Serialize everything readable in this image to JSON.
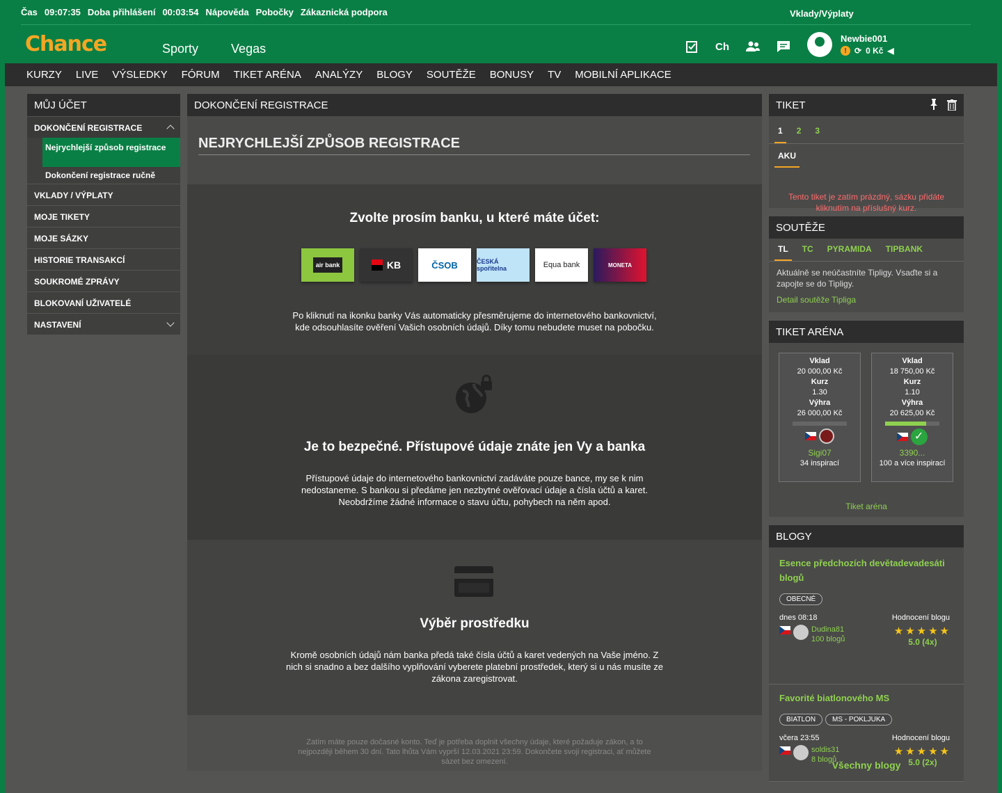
{
  "topbar": {
    "time_label": "Čas",
    "time": "09:07:35",
    "login_label": "Doba přihlášení",
    "login_time": "00:03:54",
    "links": [
      "Nápověda",
      "Pobočky",
      "Zákaznická podpora"
    ],
    "deposits": "Vklady/Výplaty"
  },
  "header": {
    "logo": "Chance",
    "nav": [
      "Sporty",
      "Vegas"
    ],
    "icons": [
      "ticket-check-icon",
      "ch-logo-icon",
      "users-icon",
      "chat-icon"
    ],
    "ch_text": "Ch",
    "user": {
      "name": "Newbie001",
      "warn": "!",
      "balance": "0 Kč"
    }
  },
  "mainnav": [
    "KURZY",
    "LIVE",
    "VÝSLEDKY",
    "FÓRUM",
    "TIKET ARÉNA",
    "ANALÝZY",
    "BLOGY",
    "SOUTĚŽE",
    "BONUSY",
    "TV",
    "MOBILNÍ APLIKACE"
  ],
  "leftmenu": {
    "title": "MŮJ ÚČET",
    "open_item": "DOKONČENÍ REGISTRACE",
    "subitems": [
      "Nejrychlejší způsob registrace",
      "Dokončení registrace ručně"
    ],
    "items": [
      "VKLADY / VÝPLATY",
      "MOJE TIKETY",
      "MOJE SÁZKY",
      "HISTORIE TRANSAKCÍ",
      "SOUKROMÉ ZPRÁVY",
      "BLOKOVANÍ UŽIVATELÉ",
      "NASTAVENÍ"
    ]
  },
  "center": {
    "title": "DOKONČENÍ REGISTRACE",
    "heading": "NEJRYCHLEJŠÍ ZPŮSOB REGISTRACE",
    "choose": "Zvolte prosím banku, u které máte účet:",
    "banks": [
      "air bank",
      "KB",
      "ČSOB",
      "ČESKÁ spořitelna",
      "Equa bank",
      "MONETA"
    ],
    "info1": "Po kliknutí na ikonku banky Vás automaticky přesměrujeme do internetového bankovnictví, kde odsouhlasíte ověření Vašich osobních údajů. Díky tomu nebudete muset na pobočku.",
    "safe_title": "Je to bezpečné. Přístupové údaje znáte jen Vy a banka",
    "safe_text": "Přístupové údaje do internetového bankovnictví zadáváte pouze bance, my se k nim nedostaneme. S bankou si předáme jen nezbytné ověřovací údaje a čísla účtů a karet. Neobdržíme žádné informace o stavu účtu, pohybech na něm apod.",
    "choice_title": "Výběr prostředku",
    "choice_text": "Kromě osobních údajů nám banka předá také čísla účtů a karet vedených na Vaše jméno. Z nich si snadno a bez dalšího vyplňování vyberete platební prostředek, který si u nás musíte ze zákona zaregistrovat.",
    "footer": "Zatím máte pouze dočasné konto. Teď je potřeba doplnit všechny údaje, které požaduje zákon, a to nejpozději během 30 dní. Tato lhůta Vám vyprší 12.03.2021 23:59. Dokončete svoji registraci, ať můžete sázet bez omezení."
  },
  "ticket": {
    "title": "TIKET",
    "tabs": [
      "1",
      "2",
      "3"
    ],
    "type": "AKU",
    "empty": "Tento tiket je zatím prázdný, sázku přidáte kliknutím na příslušný kurz."
  },
  "contests": {
    "title": "SOUTĚŽE",
    "tabs": [
      "TL",
      "TC",
      "PYRAMIDA",
      "TIPBANK"
    ],
    "text": "Aktuálně se neúčastníte Tipligy. Vsaďte si a zapojte se do Tipligy.",
    "link": "Detail soutěže Tipliga"
  },
  "arena": {
    "title": "TIKET ARÉNA",
    "stake_label": "Vklad",
    "odds_label": "Kurz",
    "win_label": "Výhra",
    "cards": [
      {
        "stake": "20 000,00 Kč",
        "odds": "1.30",
        "win": "26 000,00 Kč",
        "progress": 0,
        "flag": "CZ",
        "user": "Sigi07",
        "inspirations": "34 inspirací"
      },
      {
        "stake": "18 750,00 Kč",
        "odds": "1.10",
        "win": "20 625,00 Kč",
        "progress": 0.75,
        "flag": "Ch",
        "user": "3390...",
        "inspirations": "100 a více inspirací"
      }
    ],
    "link": "Tiket aréna"
  },
  "blogs": {
    "title": "BLOGY",
    "rating_label": "Hodnocení blogu",
    "items": [
      {
        "title": "Esence předchozích devětadevadesáti blogů",
        "tags": [
          "OBECNÉ"
        ],
        "time": "dnes 08:18",
        "flag": "CZ",
        "author": "Dudina81",
        "count": "100 blogů",
        "stars": "★★★★★",
        "rating": "5.0",
        "votes": "(4x)"
      },
      {
        "title": "Favorité biatlonového MS",
        "tags": [
          "BIATLON",
          "MS - POKLJUKA"
        ],
        "time": "včera 23:55",
        "flag": "Ch",
        "author": "soldis31",
        "count": "8 blogů",
        "stars": "★★★★★",
        "rating": "5.0",
        "votes": "(2x)"
      }
    ],
    "all": "Všechny blogy"
  }
}
